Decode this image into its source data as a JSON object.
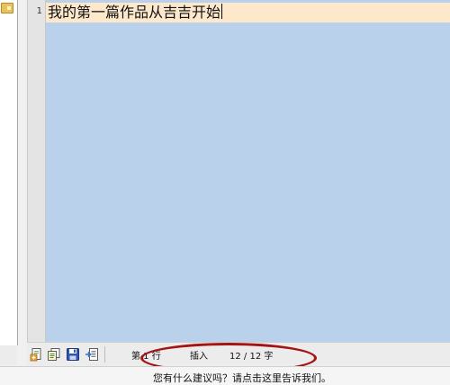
{
  "editor": {
    "line_number": "1",
    "line_text": "我的第一篇作品从吉吉开始"
  },
  "toolbar": {
    "icons": [
      "new-document-icon",
      "copy-document-icon",
      "save-icon",
      "export-icon"
    ]
  },
  "status": {
    "line_label": "第 1 行",
    "mode_label": "插入",
    "char_count": "12 / 12 字"
  },
  "feedback": {
    "text": "您有什么建议吗？请点击这里告诉我们。"
  },
  "colors": {
    "editor_bg": "#b9d1ea",
    "current_line_bg": "#fde8cc",
    "highlight_ellipse": "#a31414"
  }
}
